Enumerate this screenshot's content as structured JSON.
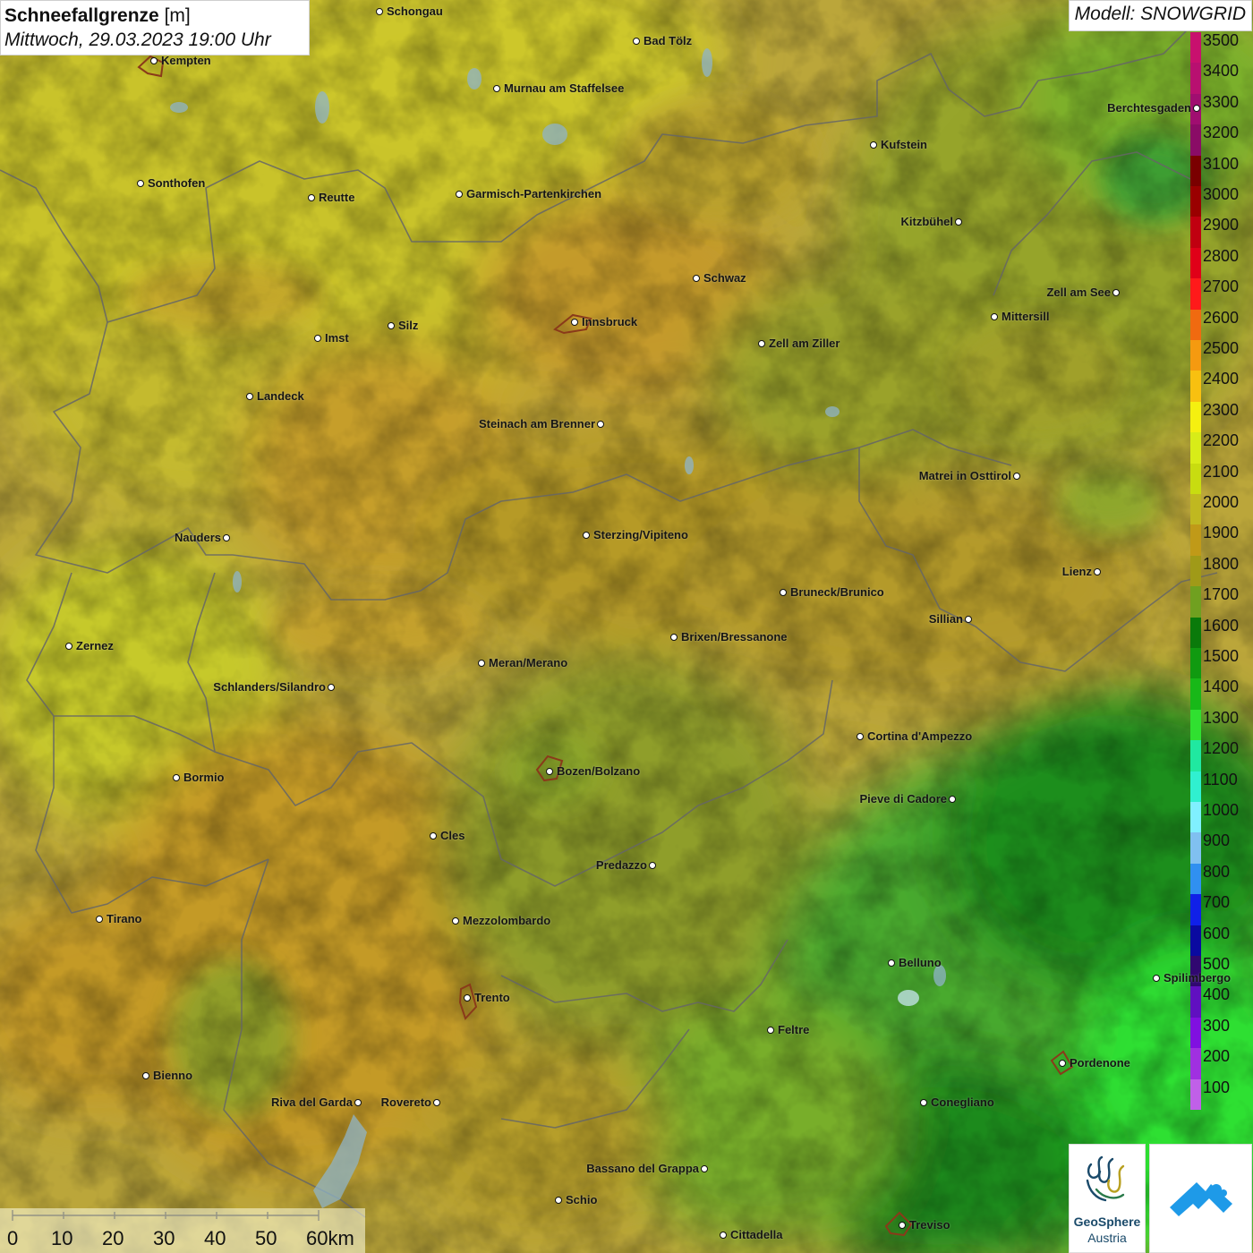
{
  "title": {
    "main": "Schneefallgrenze",
    "unit": "[m]",
    "datetime": "Mittwoch, 29.03.2023 19:00 Uhr"
  },
  "model": "Modell: SNOWGRID",
  "legend": {
    "items": [
      {
        "value": "3500",
        "color": "#c8106e"
      },
      {
        "value": "3400",
        "color": "#b81070"
      },
      {
        "value": "3300",
        "color": "#a00e70"
      },
      {
        "value": "3200",
        "color": "#8a0c66"
      },
      {
        "value": "3100",
        "color": "#7a0000"
      },
      {
        "value": "3000",
        "color": "#9a0000"
      },
      {
        "value": "2900",
        "color": "#c00010"
      },
      {
        "value": "2800",
        "color": "#e00018"
      },
      {
        "value": "2700",
        "color": "#ff1a1a"
      },
      {
        "value": "2600",
        "color": "#f06a10"
      },
      {
        "value": "2500",
        "color": "#f59a10"
      },
      {
        "value": "2400",
        "color": "#f8c010"
      },
      {
        "value": "2300",
        "color": "#f5f010"
      },
      {
        "value": "2200",
        "color": "#d8ec18"
      },
      {
        "value": "2100",
        "color": "#c8dc10"
      },
      {
        "value": "2000",
        "color": "#c0b820"
      },
      {
        "value": "1900",
        "color": "#c09a18"
      },
      {
        "value": "1800",
        "color": "#a09a18"
      },
      {
        "value": "1700",
        "color": "#70a020"
      },
      {
        "value": "1600",
        "color": "#0a7a0a"
      },
      {
        "value": "1500",
        "color": "#109a10"
      },
      {
        "value": "1400",
        "color": "#18b818"
      },
      {
        "value": "1300",
        "color": "#30e030"
      },
      {
        "value": "1200",
        "color": "#20e8a0"
      },
      {
        "value": "1100",
        "color": "#30f0d0"
      },
      {
        "value": "1000",
        "color": "#80f0ff"
      },
      {
        "value": "900",
        "color": "#80c0f0"
      },
      {
        "value": "800",
        "color": "#3090f0"
      },
      {
        "value": "700",
        "color": "#1020e8"
      },
      {
        "value": "600",
        "color": "#0a0aa0"
      },
      {
        "value": "500",
        "color": "#300870"
      },
      {
        "value": "400",
        "color": "#6010c0"
      },
      {
        "value": "300",
        "color": "#8010e0"
      },
      {
        "value": "200",
        "color": "#a030e0"
      },
      {
        "value": "100",
        "color": "#c060e8"
      }
    ]
  },
  "scale": {
    "ticks": [
      "0",
      "10",
      "20",
      "30",
      "40",
      "50",
      "60km"
    ]
  },
  "cities": [
    {
      "name": "Schongau",
      "side": "right"
    },
    {
      "name": "Bad Tölz",
      "side": "right"
    },
    {
      "name": "Kempten",
      "side": "right"
    },
    {
      "name": "Murnau am Staffelsee",
      "side": "right"
    },
    {
      "name": "Berchtesgaden",
      "side": "left"
    },
    {
      "name": "Kufstein",
      "side": "right"
    },
    {
      "name": "Sonthofen",
      "side": "right"
    },
    {
      "name": "Reutte",
      "side": "right"
    },
    {
      "name": "Garmisch-Partenkirchen",
      "side": "right"
    },
    {
      "name": "Kitzbühel",
      "side": "left"
    },
    {
      "name": "Schwaz",
      "side": "right"
    },
    {
      "name": "Zell am See",
      "side": "left"
    },
    {
      "name": "Innsbruck",
      "side": "right"
    },
    {
      "name": "Mittersill",
      "side": "right"
    },
    {
      "name": "Silz",
      "side": "right"
    },
    {
      "name": "Imst",
      "side": "right"
    },
    {
      "name": "Zell am Ziller",
      "side": "right"
    },
    {
      "name": "Landeck",
      "side": "right"
    },
    {
      "name": "Steinach am Brenner",
      "side": "left"
    },
    {
      "name": "Matrei in Osttirol",
      "side": "left"
    },
    {
      "name": "Nauders",
      "side": "left"
    },
    {
      "name": "Sterzing/Vipiteno",
      "side": "right"
    },
    {
      "name": "Lienz",
      "side": "left"
    },
    {
      "name": "Bruneck/Brunico",
      "side": "right"
    },
    {
      "name": "Sillian",
      "side": "left"
    },
    {
      "name": "Zernez",
      "side": "right"
    },
    {
      "name": "Brixen/Bressanone",
      "side": "right"
    },
    {
      "name": "Meran/Merano",
      "side": "right"
    },
    {
      "name": "Schlanders/Silandro",
      "side": "left"
    },
    {
      "name": "Cortina d'Ampezzo",
      "side": "right"
    },
    {
      "name": "Bozen/Bolzano",
      "side": "right"
    },
    {
      "name": "Bormio",
      "side": "right"
    },
    {
      "name": "Pieve di Cadore",
      "side": "left"
    },
    {
      "name": "Cles",
      "side": "right"
    },
    {
      "name": "Predazzo",
      "side": "left"
    },
    {
      "name": "Tirano",
      "side": "right"
    },
    {
      "name": "Mezzolombardo",
      "side": "right"
    },
    {
      "name": "Belluno",
      "side": "right"
    },
    {
      "name": "Spilimbergo",
      "side": "right"
    },
    {
      "name": "Trento",
      "side": "right"
    },
    {
      "name": "Feltre",
      "side": "right"
    },
    {
      "name": "Pordenone",
      "side": "right"
    },
    {
      "name": "Bienno",
      "side": "right"
    },
    {
      "name": "Riva del Garda",
      "side": "left"
    },
    {
      "name": "Rovereto",
      "side": "left"
    },
    {
      "name": "Conegliano",
      "side": "right"
    },
    {
      "name": "Bassano del Grappa",
      "side": "left"
    },
    {
      "name": "Schio",
      "side": "right"
    },
    {
      "name": "Treviso",
      "side": "right"
    },
    {
      "name": "Cittadella",
      "side": "right"
    }
  ],
  "logos": {
    "geosphere_line1": "GeoSphere",
    "geosphere_line2": "Austria"
  }
}
